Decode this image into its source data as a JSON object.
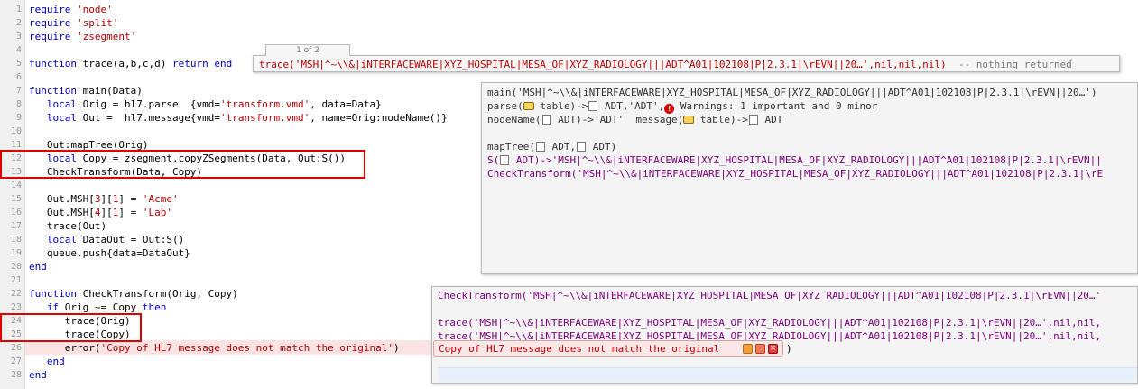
{
  "lines": [
    {
      "n": "1",
      "text": "require 'node'"
    },
    {
      "n": "2",
      "text": "require 'split'"
    },
    {
      "n": "3",
      "text": "require 'zsegment'"
    },
    {
      "n": "4",
      "text": ""
    },
    {
      "n": "5",
      "text": "function trace(a,b,c,d) return end"
    },
    {
      "n": "6",
      "text": ""
    },
    {
      "n": "7",
      "text": "function main(Data)"
    },
    {
      "n": "8",
      "text": "   local Orig = hl7.parse  {vmd='transform.vmd', data=Data}"
    },
    {
      "n": "9",
      "text": "   local Out =  hl7.message{vmd='transform.vmd', name=Orig:nodeName()}"
    },
    {
      "n": "10",
      "text": ""
    },
    {
      "n": "11",
      "text": "   Out:mapTree(Orig)"
    },
    {
      "n": "12",
      "text": "   local Copy = zsegment.copyZSegments(Data, Out:S())"
    },
    {
      "n": "13",
      "text": "   CheckTransform(Data, Copy)"
    },
    {
      "n": "14",
      "text": ""
    },
    {
      "n": "15",
      "text": "   Out.MSH[3][1] = 'Acme'"
    },
    {
      "n": "16",
      "text": "   Out.MSH[4][1] = 'Lab'"
    },
    {
      "n": "17",
      "text": "   trace(Out)"
    },
    {
      "n": "18",
      "text": "   local DataOut = Out:S()"
    },
    {
      "n": "19",
      "text": "   queue.push{data=DataOut}"
    },
    {
      "n": "20",
      "text": "end"
    },
    {
      "n": "21",
      "text": ""
    },
    {
      "n": "22",
      "text": "function CheckTransform(Orig, Copy)"
    },
    {
      "n": "23",
      "text": "   if Orig ~= Copy then"
    },
    {
      "n": "24",
      "text": "      trace(Orig)"
    },
    {
      "n": "25",
      "text": "      trace(Copy)"
    },
    {
      "n": "26",
      "text": "      error('Copy of HL7 message does not match the original')"
    },
    {
      "n": "27",
      "text": "   end"
    },
    {
      "n": "28",
      "text": "end"
    }
  ],
  "trace_popup": {
    "counter": "1 of 2",
    "text": "trace('MSH|^~\\\\&|iNTERFACEWARE|XYZ_HOSPITAL|MESA_OF|XYZ_RADIOLOGY|||ADT^A01|102108|P|2.3.1|\\rEVN||20…',nil,nil,nil)",
    "comment": "-- nothing returned"
  },
  "main_popup": {
    "l1": "main('MSH|^~\\\\&|iNTERFACEWARE|XYZ_HOSPITAL|MESA_OF|XYZ_RADIOLOGY|||ADT^A01|102108|P|2.3.1|\\rEVN||20…')",
    "l2a": "parse(",
    "l2b": " table)->",
    "l2c": " ADT,'ADT',",
    "l2d": " Warnings: 1 important and 0 minor",
    "l3a": "nodeName(",
    "l3b": " ADT)->'ADT'  message(",
    "l3c": " table)->",
    "l3d": " ADT",
    "l5a": "mapTree(",
    "l5b": " ADT,",
    "l5c": " ADT)",
    "l6a": "S(",
    "l6b": " ADT)->'MSH|^~\\\\&|iNTERFACEWARE|XYZ_HOSPITAL|MESA_OF|XYZ_RADIOLOGY|||ADT^A01|102108|P|2.3.1|\\rEVN||",
    "l7": "CheckTransform('MSH|^~\\\\&|iNTERFACEWARE|XYZ_HOSPITAL|MESA_OF|XYZ_RADIOLOGY|||ADT^A01|102108|P|2.3.1|\\rE"
  },
  "check_popup": {
    "l1": "CheckTransform('MSH|^~\\\\&|iNTERFACEWARE|XYZ_HOSPITAL|MESA_OF|XYZ_RADIOLOGY|||ADT^A01|102108|P|2.3.1|\\rEVN||20…'",
    "l2": "trace('MSH|^~\\\\&|iNTERFACEWARE|XYZ_HOSPITAL|MESA_OF|XYZ_RADIOLOGY|||ADT^A01|102108|P|2.3.1|\\rEVN||20…',nil,nil,",
    "l3": "trace('MSH|^~\\\\&|iNTERFACEWARE|XYZ_HOSPITAL|MESA_OF|XYZ_RADIOLOGY|||ADT^A01|102108|P|2.3.1|\\rEVN||20…',nil,nil,"
  },
  "error_popup": {
    "text": "Copy of HL7 message does not match the original",
    "close_paren": ")"
  }
}
